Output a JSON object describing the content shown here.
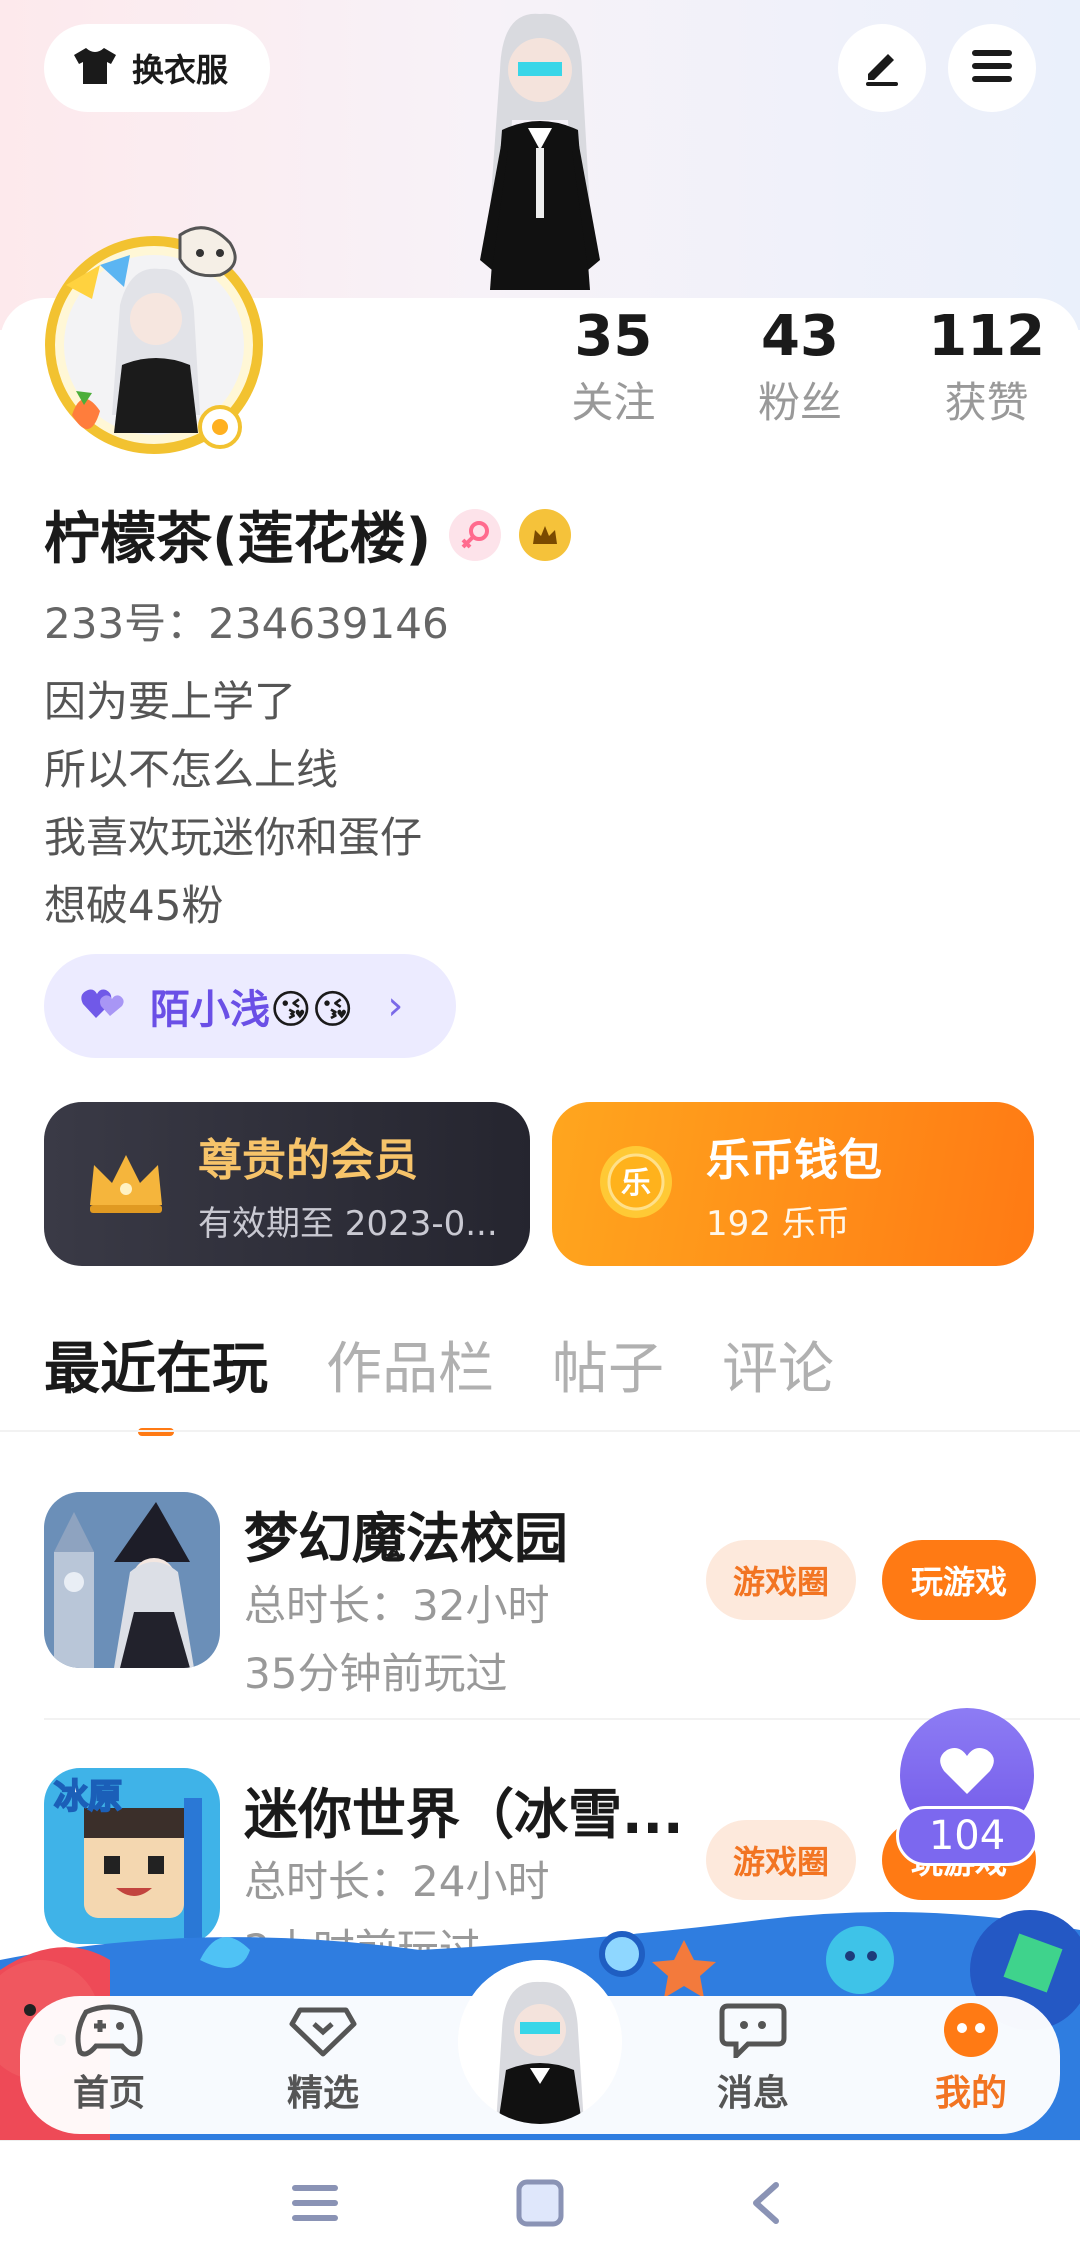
{
  "header": {
    "costume_label": "换衣服"
  },
  "stats": [
    {
      "value": "35",
      "label": "关注"
    },
    {
      "value": "43",
      "label": "粉丝"
    },
    {
      "value": "112",
      "label": "获赞"
    }
  ],
  "profile": {
    "name": "柠檬茶(莲花楼)",
    "uid": "233号：234639146",
    "bio": [
      "因为要上学了",
      "所以不怎么上线",
      "我喜欢玩迷你和蛋仔",
      "想破45粉"
    ]
  },
  "cp": {
    "name": "陌小浅",
    "emoji": "😘😘"
  },
  "vip": {
    "title": "尊贵的会员",
    "subtitle": "有效期至 2023-0..."
  },
  "wallet": {
    "title": "乐币钱包",
    "subtitle": "192 乐币",
    "coin_char": "乐"
  },
  "tabs": [
    "最近在玩",
    "作品栏",
    "帖子",
    "评论"
  ],
  "games": [
    {
      "name": "梦幻魔法校园",
      "duration": "总时长：32小时",
      "last_played": "35分钟前玩过",
      "circle_label": "游戏圈",
      "play_label": "玩游戏"
    },
    {
      "name": "迷你世界（冰雪...",
      "duration": "总时长：24小时",
      "last_played": "2小时前玩过",
      "circle_label": "游戏圈",
      "play_label": "玩游戏",
      "thumb_text": "冰原"
    }
  ],
  "likes": {
    "count": "104"
  },
  "nav": {
    "items": [
      {
        "label": "首页"
      },
      {
        "label": "精选"
      },
      {
        "label": "消息"
      },
      {
        "label": "我的"
      }
    ]
  },
  "colors": {
    "accent": "#ff7a14",
    "purple": "#7259e9",
    "vip_gold": "#f7c46a"
  }
}
